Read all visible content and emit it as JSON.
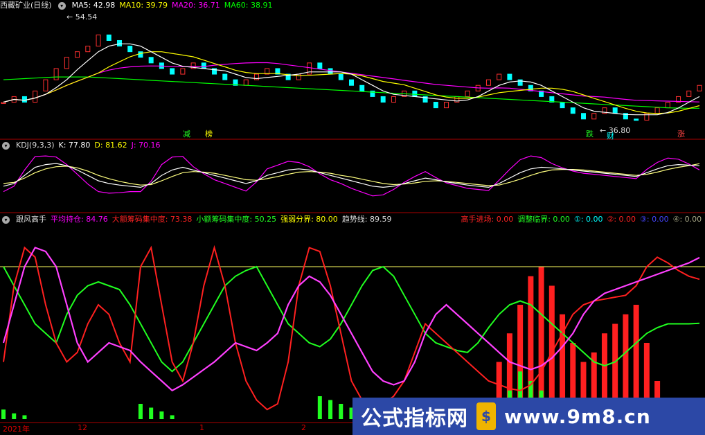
{
  "legend1": {
    "title": "西藏矿业(日线)",
    "ma5": "MA5: 42.98",
    "ma10": "MA10: 39.79",
    "ma20": "MA20: 36.71",
    "ma60": "MA60: 38.91"
  },
  "legend2": {
    "title": "KDJ(9,3,3)",
    "k": "K: 77.80",
    "d": "D: 81.62",
    "j": "J: 70.16"
  },
  "legend3": {
    "title": "跟风高手",
    "avg": "平均持仓: 84.76",
    "big": "大额筹码集中度: 73.38",
    "small": "小额筹码集中度: 50.25",
    "strong": "强弱分界: 80.00",
    "trend": "趋势线: 89.59",
    "gaoshou": "高手进场: 0.00",
    "tiaozheng": "调整临界: 0.00",
    "c1": "①: 0.00",
    "c2": "②: 0.00",
    "c3": "③: 0.00",
    "c4": "④: 0.00"
  },
  "colors": {
    "ma5": "#ffffff",
    "ma10": "#ffff00",
    "ma20": "#ff00ff",
    "ma60": "#00ff00",
    "red": "#ff2020",
    "green": "#20ff20",
    "cyan": "#00ffff"
  },
  "annotations": {
    "high": "54.54",
    "low": "36.80",
    "jian": "减",
    "bang": "榜",
    "die": "跌",
    "cai": "财",
    "zhang": "涨"
  },
  "xaxis": {
    "y2021": "2021年",
    "m12": "12",
    "m1": "1",
    "m2": "2"
  },
  "watermark": {
    "left": "公式指标网",
    "logo": "$",
    "right": "www.9m8.cn"
  },
  "chart_data": {
    "type": "line",
    "price": {
      "close": [
        40,
        41,
        40,
        42,
        44,
        46,
        48,
        49,
        50,
        52,
        51,
        50,
        49,
        48,
        47,
        46,
        45,
        46,
        47,
        46,
        45,
        44,
        43,
        44,
        45,
        46,
        45,
        44,
        45,
        47,
        46,
        45,
        44,
        43,
        42,
        41,
        40,
        41,
        42,
        41,
        40,
        39,
        40,
        41,
        42,
        43,
        44,
        45,
        44,
        43,
        42,
        41,
        40,
        39,
        38,
        37,
        38,
        39,
        38,
        37,
        36.8,
        38,
        39,
        40,
        41,
        42,
        43
      ],
      "ma60": [
        44,
        44.1,
        44.2,
        44.3,
        44.4,
        44.5,
        44.5,
        44.5,
        44.5,
        44.4,
        44.3,
        44.2,
        44.1,
        44,
        43.9,
        43.8,
        43.7,
        43.6,
        43.5,
        43.4,
        43.3,
        43.2,
        43.1,
        43,
        42.9,
        42.8,
        42.7,
        42.6,
        42.5,
        42.4,
        42.3,
        42.2,
        42.1,
        42,
        41.9,
        41.8,
        41.7,
        41.6,
        41.5,
        41.4,
        41.3,
        41.2,
        41.1,
        41,
        40.9,
        40.8,
        40.7,
        40.6,
        40.5,
        40.4,
        40.3,
        40.2,
        40.1,
        40,
        39.9,
        39.8,
        39.7,
        39.6,
        39.5,
        39.4,
        39.3,
        39.2,
        39.1,
        39,
        38.95,
        38.92,
        38.91
      ]
    },
    "kdj": {
      "K": [
        40,
        45,
        60,
        75,
        80,
        82,
        78,
        70,
        60,
        50,
        45,
        42,
        40,
        38,
        45,
        60,
        70,
        75,
        70,
        65,
        60,
        55,
        50,
        45,
        50,
        60,
        65,
        70,
        72,
        70,
        65,
        60,
        55,
        50,
        45,
        40,
        38,
        40,
        45,
        50,
        55,
        52,
        48,
        45,
        42,
        40,
        38,
        45,
        55,
        65,
        72,
        75,
        74,
        72,
        70,
        68,
        66,
        64,
        62,
        60,
        58,
        65,
        72,
        78,
        80,
        79,
        77.8
      ],
      "D": [
        45,
        47,
        55,
        65,
        72,
        76,
        77,
        74,
        68,
        60,
        54,
        49,
        45,
        42,
        43,
        50,
        58,
        65,
        67,
        66,
        64,
        60,
        56,
        52,
        51,
        54,
        58,
        62,
        66,
        67,
        66,
        64,
        60,
        57,
        53,
        49,
        45,
        43,
        44,
        46,
        49,
        50,
        49,
        47,
        45,
        43,
        41,
        42,
        47,
        53,
        60,
        66,
        70,
        71,
        71,
        70,
        68,
        66,
        64,
        62,
        60,
        62,
        66,
        71,
        75,
        78,
        81.62
      ],
      "J": [
        30,
        40,
        70,
        95,
        96,
        94,
        80,
        62,
        44,
        30,
        27,
        28,
        30,
        30,
        49,
        80,
        94,
        95,
        76,
        63,
        52,
        45,
        38,
        31,
        48,
        72,
        79,
        86,
        84,
        76,
        63,
        52,
        45,
        36,
        29,
        22,
        24,
        34,
        47,
        58,
        67,
        56,
        46,
        41,
        36,
        34,
        32,
        51,
        71,
        89,
        96,
        93,
        82,
        74,
        68,
        64,
        62,
        60,
        58,
        56,
        54,
        71,
        84,
        92,
        90,
        81,
        70.16
      ]
    },
    "indicator": {
      "avg_holding": [
        40,
        60,
        80,
        90,
        88,
        80,
        60,
        40,
        30,
        35,
        40,
        38,
        36,
        30,
        25,
        20,
        15,
        18,
        22,
        26,
        30,
        35,
        40,
        38,
        36,
        40,
        45,
        60,
        70,
        75,
        72,
        65,
        55,
        45,
        35,
        25,
        20,
        18,
        20,
        30,
        45,
        55,
        60,
        55,
        50,
        45,
        40,
        35,
        30,
        28,
        26,
        28,
        32,
        38,
        45,
        55,
        62,
        66,
        68,
        70,
        72,
        74,
        76,
        78,
        80,
        82,
        84.76
      ],
      "big_chip": [
        30,
        70,
        90,
        85,
        60,
        40,
        30,
        35,
        50,
        60,
        55,
        40,
        30,
        80,
        90,
        60,
        30,
        20,
        40,
        70,
        90,
        70,
        40,
        20,
        10,
        5,
        8,
        30,
        70,
        90,
        88,
        70,
        45,
        20,
        10,
        5,
        8,
        12,
        20,
        35,
        50,
        45,
        40,
        35,
        30,
        25,
        20,
        18,
        16,
        15,
        18,
        25,
        35,
        45,
        55,
        60,
        62,
        63,
        64,
        65,
        70,
        80,
        85,
        82,
        78,
        75,
        73.38
      ],
      "small_chip": [
        80,
        70,
        60,
        50,
        45,
        40,
        55,
        65,
        70,
        72,
        70,
        68,
        60,
        50,
        40,
        30,
        25,
        30,
        40,
        50,
        60,
        70,
        75,
        78,
        80,
        70,
        60,
        50,
        45,
        40,
        38,
        42,
        50,
        60,
        70,
        78,
        80,
        75,
        65,
        55,
        45,
        40,
        38,
        36,
        35,
        40,
        48,
        55,
        60,
        62,
        60,
        55,
        50,
        45,
        40,
        35,
        30,
        28,
        30,
        35,
        40,
        45,
        48,
        50,
        50,
        50,
        50.25
      ],
      "strong_line": 80,
      "trend": 89.59,
      "bars_red": [
        0,
        0,
        0,
        0,
        0,
        0,
        0,
        0,
        0,
        0,
        0,
        0,
        0,
        0,
        0,
        0,
        0,
        0,
        0,
        0,
        0,
        0,
        0,
        0,
        0,
        0,
        0,
        0,
        0,
        0,
        0,
        0,
        0,
        0,
        0,
        0,
        0,
        0,
        0,
        0,
        0,
        0,
        0,
        0,
        0,
        0,
        0,
        30,
        45,
        60,
        75,
        80,
        70,
        55,
        40,
        30,
        35,
        45,
        50,
        55,
        60,
        40,
        20,
        0,
        0,
        0,
        0
      ],
      "bars_green": [
        5,
        3,
        2,
        0,
        0,
        0,
        0,
        0,
        0,
        0,
        0,
        0,
        0,
        8,
        6,
        4,
        2,
        0,
        0,
        0,
        0,
        0,
        0,
        0,
        0,
        0,
        0,
        0,
        0,
        0,
        12,
        10,
        8,
        6,
        4,
        2,
        0,
        0,
        0,
        0,
        0,
        0,
        0,
        0,
        0,
        0,
        0,
        5,
        15,
        25,
        20,
        15,
        10,
        5,
        0,
        0,
        0,
        0,
        0,
        0,
        0,
        10,
        5,
        0,
        0,
        0,
        0
      ]
    }
  }
}
